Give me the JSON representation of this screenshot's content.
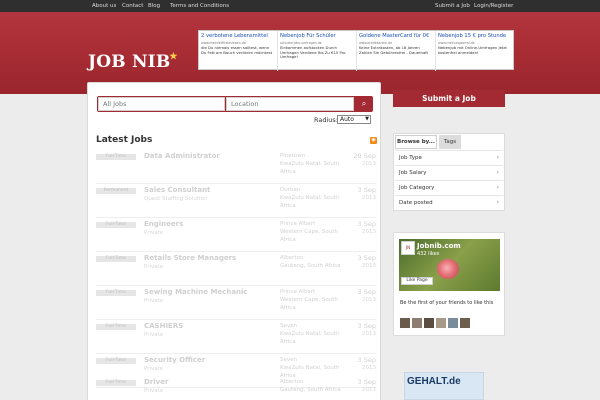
{
  "topnav": {
    "items": [
      "About us",
      "Contact",
      "Blog",
      "Terms and Conditions"
    ]
  },
  "topnav_right": {
    "items": [
      "Submit a Job",
      "Login/Register"
    ]
  },
  "brand": {
    "name": "JOB NIB"
  },
  "ads": [
    {
      "title": "2 verbotene Lebensmittel",
      "url": "www.meinfettfreiesleben.de",
      "desc": "die Du niemals essen solltest, wenn Du Fett am Bauch verlieren möchtest"
    },
    {
      "title": "Nebenjob Für Schüler",
      "url": "schuelerjobs.umfragen.de",
      "desc": "Einkommen aufstocken Durch Umfragen Verdiene Bis Zu €15 Pro Umfrage!"
    },
    {
      "title": "Goldene MasterCard für 0€",
      "url": "www.kreditkarten.de",
      "desc": "Keine Extrakosten, ab 18 Jahren Zahlen Sie Gebührenfrei - Dauerhaft"
    },
    {
      "title": "Nebenjob 15 € pro Stunde",
      "url": "www.meinungsortal.de",
      "desc": "Nebenjob mit Online-Umfragen Jetzt kostenfrei anmelden!"
    }
  ],
  "search": {
    "jobs_placeholder": "All Jobs",
    "location_placeholder": "Location",
    "radius_label": "Radius:",
    "radius_value": "Auto"
  },
  "latest": {
    "title": "Latest Jobs"
  },
  "jobs": [
    {
      "badge": "Full-Time",
      "title": "Data Administrator",
      "company": "",
      "loc1": "Pinetown",
      "loc2": "KwaZulu Natal, South",
      "loc3": "Africa",
      "date": "29 Sep",
      "year": "2013"
    },
    {
      "badge": "Permanent",
      "title": "Sales Consultant",
      "company": "Quest Staffing Solution",
      "loc1": "Durban",
      "loc2": "KwaZulu Natal, South",
      "loc3": "Africa",
      "date": "3 Sep",
      "year": "2013"
    },
    {
      "badge": "Full-Time",
      "title": "Engineers",
      "company": "Private",
      "loc1": "Prince Albert",
      "loc2": "Western Cape, South",
      "loc3": "Africa",
      "date": "3 Sep",
      "year": "2013"
    },
    {
      "badge": "Full-Time",
      "title": "Retails Store Managers",
      "company": "Private",
      "loc1": "Alberton",
      "loc2": "Gauteng, South Africa",
      "loc3": "",
      "date": "3 Sep",
      "year": "2013"
    },
    {
      "badge": "Full-Time",
      "title": "Sewing Machine Mechanic",
      "company": "Private",
      "loc1": "Prince Albert",
      "loc2": "Western Cape, South",
      "loc3": "Africa",
      "date": "3 Sep",
      "year": "2013"
    },
    {
      "badge": "Full-Time",
      "title": "CASHIERS",
      "company": "Private",
      "loc1": "Seven",
      "loc2": "KwaZulu Natal, South",
      "loc3": "Africa",
      "date": "3 Sep",
      "year": "2013"
    },
    {
      "badge": "Full-Time",
      "title": "Security Officer",
      "company": "Private",
      "loc1": "Seven",
      "loc2": "KwaZulu Natal, South",
      "loc3": "Africa",
      "date": "3 Sep",
      "year": "2013"
    },
    {
      "badge": "Full-Time",
      "title": "Driver",
      "company": "Private",
      "loc1": "Alberton",
      "loc2": "Gauteng, South Africa",
      "loc3": "",
      "date": "3 Sep",
      "year": "2013"
    }
  ],
  "sidebar": {
    "submit_label": "Submit a Job",
    "tab_browse": "Browse by...",
    "tab_tags": "Tags",
    "filters": [
      "Job Type",
      "Job Salary",
      "Job Category",
      "Date posted"
    ]
  },
  "facebook": {
    "name": "Jobnib.com",
    "likes": "432 likes",
    "like_button": "Like Page",
    "friends_text": "Be the first of your friends to like this"
  },
  "ad2": {
    "text": "GEHALT.de"
  },
  "colors": {
    "brand_red": "#a32a32",
    "topbar": "#2f2f2f"
  }
}
